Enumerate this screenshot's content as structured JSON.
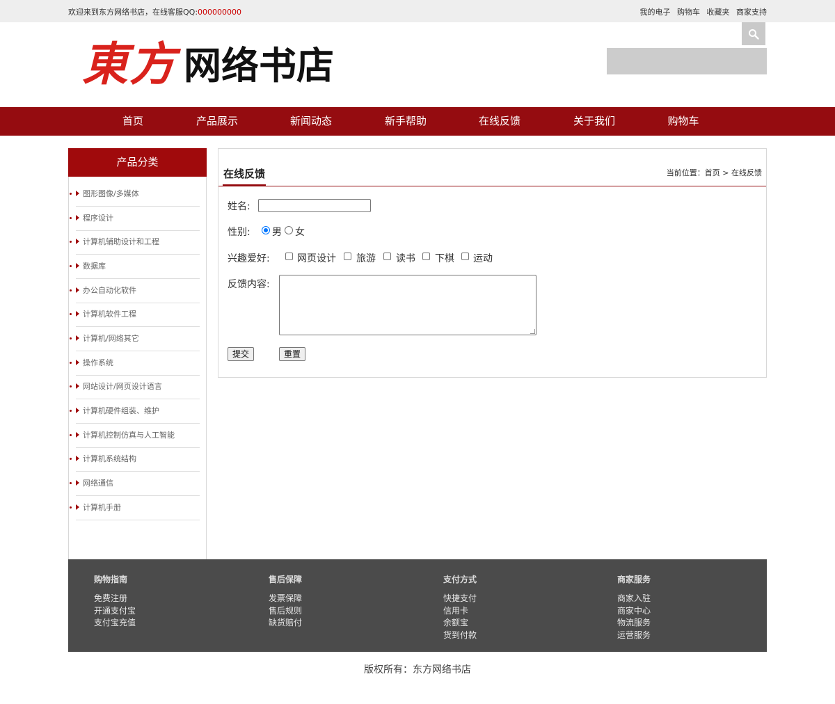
{
  "topbar": {
    "welcome": "欢迎来到东方网络书店，在线客服QQ:",
    "qq": "000000000",
    "links": [
      "我的电子",
      "购物车",
      "收藏夹",
      "商家支持"
    ]
  },
  "header": {
    "logo_red": "東方",
    "logo_black": "网络书店",
    "search_placeholder": ""
  },
  "nav": {
    "items": [
      "首页",
      "产品展示",
      "新闻动态",
      "新手帮助",
      "在线反馈",
      "关于我们",
      "购物车"
    ]
  },
  "sidebar": {
    "title": "产品分类",
    "categories": [
      "图形图像/多媒体",
      "程序设计",
      "计算机辅助设计和工程",
      "数据库",
      "办公自动化软件",
      "计算机软件工程",
      "计算机/网络其它",
      "操作系统",
      "网站设计/网页设计语言",
      "计算机硬件组装、维护",
      "计算机控制仿真与人工智能",
      "计算机系统结构",
      "网络通信",
      "计算机手册"
    ]
  },
  "content": {
    "title": "在线反馈",
    "breadcrumb": "当前位置：首页 > 在线反馈",
    "form": {
      "name_label": "姓名:",
      "name_value": "",
      "gender_label": "性别:",
      "gender_options": [
        "男",
        "女"
      ],
      "gender_selected": "男",
      "hobby_label": "兴趣爱好:",
      "hobbies": [
        "网页设计",
        "旅游",
        "读书",
        "下棋",
        "运动"
      ],
      "feedback_label": "反馈内容:",
      "feedback_value": "",
      "submit_label": "提交",
      "reset_label": "重置"
    }
  },
  "footer": {
    "columns": [
      {
        "heading": "购物指南",
        "links": [
          "免费注册",
          "开通支付宝",
          "支付宝充值"
        ]
      },
      {
        "heading": "售后保障",
        "links": [
          "发票保障",
          "售后规则",
          "缺货赔付"
        ]
      },
      {
        "heading": "支付方式",
        "links": [
          "快捷支付",
          "信用卡",
          "余额宝",
          "货到付款"
        ]
      },
      {
        "heading": "商家服务",
        "links": [
          "商家入驻",
          "商家中心",
          "物流服务",
          "运营服务"
        ]
      }
    ],
    "copyright": "版权所有：东方网络书店"
  },
  "colors": {
    "brand_red": "#950c10",
    "logo_red": "#d9221c",
    "footer_bg": "#4b4b4b"
  },
  "icons": {
    "search": "search-icon"
  }
}
